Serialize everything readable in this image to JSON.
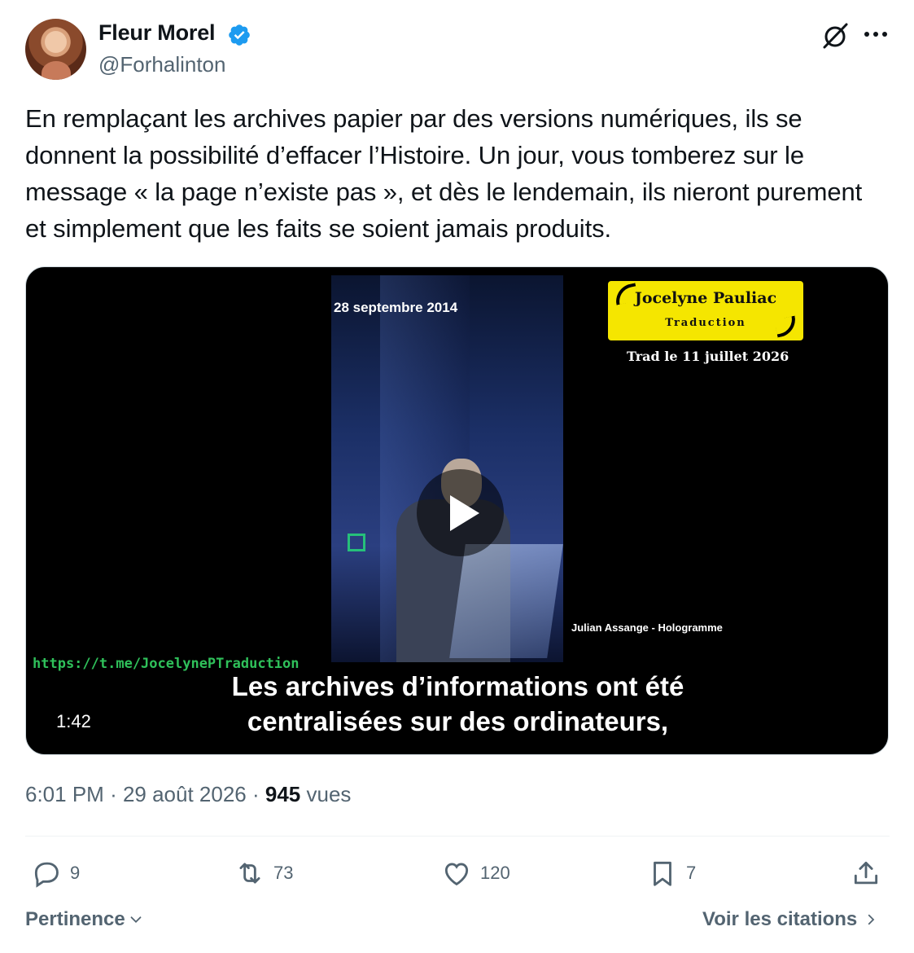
{
  "author": {
    "name": "Fleur Morel",
    "handle": "@Forhalinton",
    "verified": true
  },
  "tweet": {
    "text": "En remplaçant les archives papier par des versions numériques, ils se donnent la possibilité d’effacer l’Histoire. Un jour, vous tomberez sur le message « la page n’existe pas », et dès le lendemain, ils nieront purement et simplement que les faits se soient jamais produits."
  },
  "video": {
    "date_overlay": "28 septembre 2014",
    "brand_name": "Jocelyne Pauliac",
    "brand_sub": "Traduction",
    "trad_date": "Trad le 11 juillet 2026",
    "speaker_label": "Julian Assange - Hologramme",
    "telegram_link": "https://t.me/JocelynePTraduction",
    "subtitle_line1": "Les archives d’informations ont été",
    "subtitle_line2": "centralisées sur des ordinateurs,",
    "duration": "1:42"
  },
  "meta": {
    "time": "6:01 PM",
    "date": "29 août 2026",
    "views_count": "945",
    "views_label": "vues"
  },
  "actions": {
    "replies": "9",
    "retweets": "73",
    "likes": "120",
    "bookmarks": "7"
  },
  "footer": {
    "sort_label": "Pertinence",
    "quotes_label": "Voir les citations"
  },
  "colors": {
    "text": "#0f1419",
    "secondary": "#536471",
    "verified_blue": "#1d9bf0",
    "brand_yellow": "#f5e600",
    "link_green": "#2fc05a"
  },
  "icons": [
    "verified-badge-icon",
    "grok-icon",
    "more-icon",
    "play-icon",
    "reply-icon",
    "retweet-icon",
    "like-icon",
    "bookmark-icon",
    "share-icon",
    "chevron-down-icon",
    "chevron-right-icon"
  ]
}
